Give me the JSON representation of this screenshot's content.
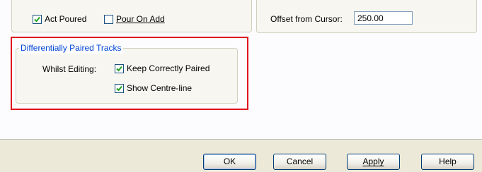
{
  "top_options": {
    "act_poured": {
      "label": "Act Poured",
      "checked": true
    },
    "pour_on_add": {
      "label": "Pour On Add",
      "checked": false
    }
  },
  "offset": {
    "label": "Offset from Cursor:",
    "value": "250.00"
  },
  "diff_pairs": {
    "title": "Differentially Paired Tracks",
    "whilst_editing_label": "Whilst Editing:",
    "keep_correctly_paired": {
      "label": "Keep Correctly Paired",
      "checked": true
    },
    "show_centre_line": {
      "label": "Show Centre-line",
      "checked": true
    }
  },
  "buttons": {
    "ok": "OK",
    "cancel": "Cancel",
    "apply": "Apply",
    "help": "Help"
  },
  "colors": {
    "group_title": "#0046d5",
    "highlight_border": "#e0141e",
    "check_mark": "#21a121"
  }
}
